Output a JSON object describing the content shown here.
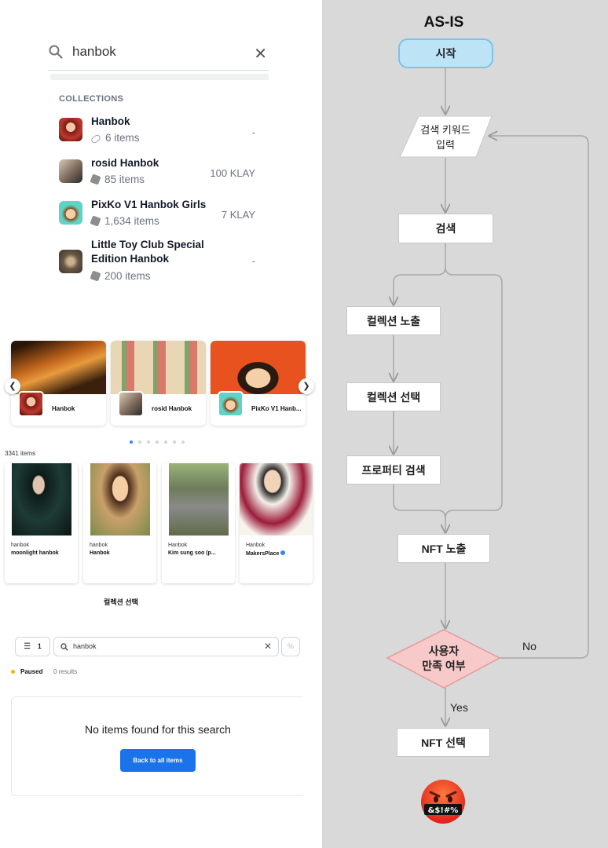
{
  "search": {
    "query": "hanbok"
  },
  "collections": {
    "heading": "COLLECTIONS",
    "items": [
      {
        "name": "Hanbok",
        "count": "6 items",
        "price": "-"
      },
      {
        "name": "rosid Hanbok",
        "count": "85 items",
        "price": "100 KLAY"
      },
      {
        "name": "PixKo V1 Hanbok Girls",
        "count": "1,634 items",
        "price": "7 KLAY"
      },
      {
        "name_line1": "Little Toy Club Special",
        "name_line2": "Edition Hanbok",
        "count": "200 items",
        "price": "-"
      }
    ]
  },
  "banner": {
    "cards": [
      {
        "label": "Hanbok"
      },
      {
        "label": "rosid Hanbok"
      },
      {
        "label": "PixKo V1 Hanb..."
      }
    ],
    "prev_icon": "chevron-left-icon",
    "next_icon": "chevron-right-icon"
  },
  "grid": {
    "count_label": "3341 items",
    "cards": [
      {
        "collection": "hanbok",
        "name": "moonlight hanbok"
      },
      {
        "collection": "hanbok",
        "name": "Hanbok"
      },
      {
        "collection": "Hanbok",
        "name": "Kim sung soo (p..."
      },
      {
        "collection": "Hanbok",
        "name": "MakersPlace"
      }
    ]
  },
  "caption": "컬렉션 선택",
  "filter": {
    "count": "1",
    "query": "hanbok",
    "status": "Paused",
    "results": "0 results",
    "empty_message": "No items found for this search",
    "back_label": "Back to all items"
  },
  "flowchart": {
    "title": "AS-IS",
    "start": "시작",
    "input_line1": "검색 키워드",
    "input_line2": "입력",
    "search": "검색",
    "show_collection": "컬렉션 노출",
    "select_collection": "컬렉션 선택",
    "property_search": "프로퍼티 검색",
    "show_nft": "NFT 노출",
    "decision_line1": "사용자",
    "decision_line2": "만족 여부",
    "no_label": "No",
    "yes_label": "Yes",
    "select_nft": "NFT 선택",
    "emoji_text": "&$!#%"
  },
  "colors": {
    "accent": "#1a73e8",
    "start_fill": "#bde3f7",
    "decision_fill": "#f8c9c9",
    "paused": "#f5b700"
  }
}
